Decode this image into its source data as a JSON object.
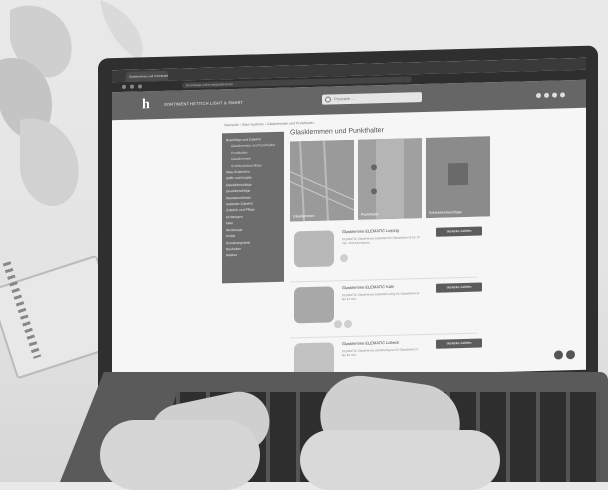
{
  "browser": {
    "tab_title": "Glasklemmen und Punkthalter",
    "url": "beschlaege-online.de/glasklemmen"
  },
  "header": {
    "nav_items": [
      "SORTIMENT",
      "HETTICH LIGHT & SMART"
    ],
    "search_placeholder": "Produkte …"
  },
  "breadcrumb": "Startseite › Glas-Systeme › Glasklemmen und Punkthalter",
  "sidebar": {
    "items": [
      {
        "label": "Beschläge und Zubehör",
        "sub": false
      },
      {
        "label": "Glasklemmen und Punkthalter",
        "sub": true
      },
      {
        "label": "Punkthalter",
        "sub": true
      },
      {
        "label": "Glasklemmen",
        "sub": true
      },
      {
        "label": "Schiebetürbeschläge",
        "sub": true
      },
      {
        "label": "Glas-Scharniere",
        "sub": false
      },
      {
        "label": "Griffe und Knöpfe",
        "sub": false
      },
      {
        "label": "Glastürbeschläge",
        "sub": false
      },
      {
        "label": "Duschbeschläge",
        "sub": false
      },
      {
        "label": "Wandanschlüsse",
        "sub": false
      },
      {
        "label": "Geländer-Zubehör",
        "sub": false
      },
      {
        "label": "Zubehör und Pflege",
        "sub": false
      },
      {
        "label": "Dichtungen",
        "sub": false
      },
      {
        "label": "Glas",
        "sub": false
      },
      {
        "label": "Werkzeuge",
        "sub": false
      },
      {
        "label": "Profile",
        "sub": false
      },
      {
        "label": "Sonderangebote",
        "sub": false
      },
      {
        "label": "Neuheiten",
        "sub": false
      },
      {
        "label": "Marken",
        "sub": false
      }
    ]
  },
  "main": {
    "title": "Glasklemmen und Punkthalter",
    "categories": [
      {
        "label": "Glasklemmen"
      },
      {
        "label": "Punkthalter"
      },
      {
        "label": "Schiebetürbeschläge"
      }
    ],
    "products": [
      {
        "name": "Glasklemme ELEMATIC Leipzig",
        "desc": "ELEMATIC Glasklemme Edelstahl für Glasstärken 8 bis 12 mm, Zink-Druckguss.",
        "button": "Variante wählen"
      },
      {
        "name": "Glasklemme ELEMATIC Köln",
        "desc": "ELEMATIC Glasklemme Edelstahl eckig für Glasstärken 8 bis 12 mm.",
        "button": "Variante wählen"
      },
      {
        "name": "Glasklemme ELEMATIC Lübeck",
        "desc": "ELEMATIC Glasklemme Zinkdruckguss für Glasstärken 6 bis 10 mm.",
        "button": "Variante wählen"
      }
    ]
  },
  "colors": {
    "header_bg": "#666666",
    "sidebar_bg": "#6d6d6d",
    "button_bg": "#5c5c5c"
  }
}
